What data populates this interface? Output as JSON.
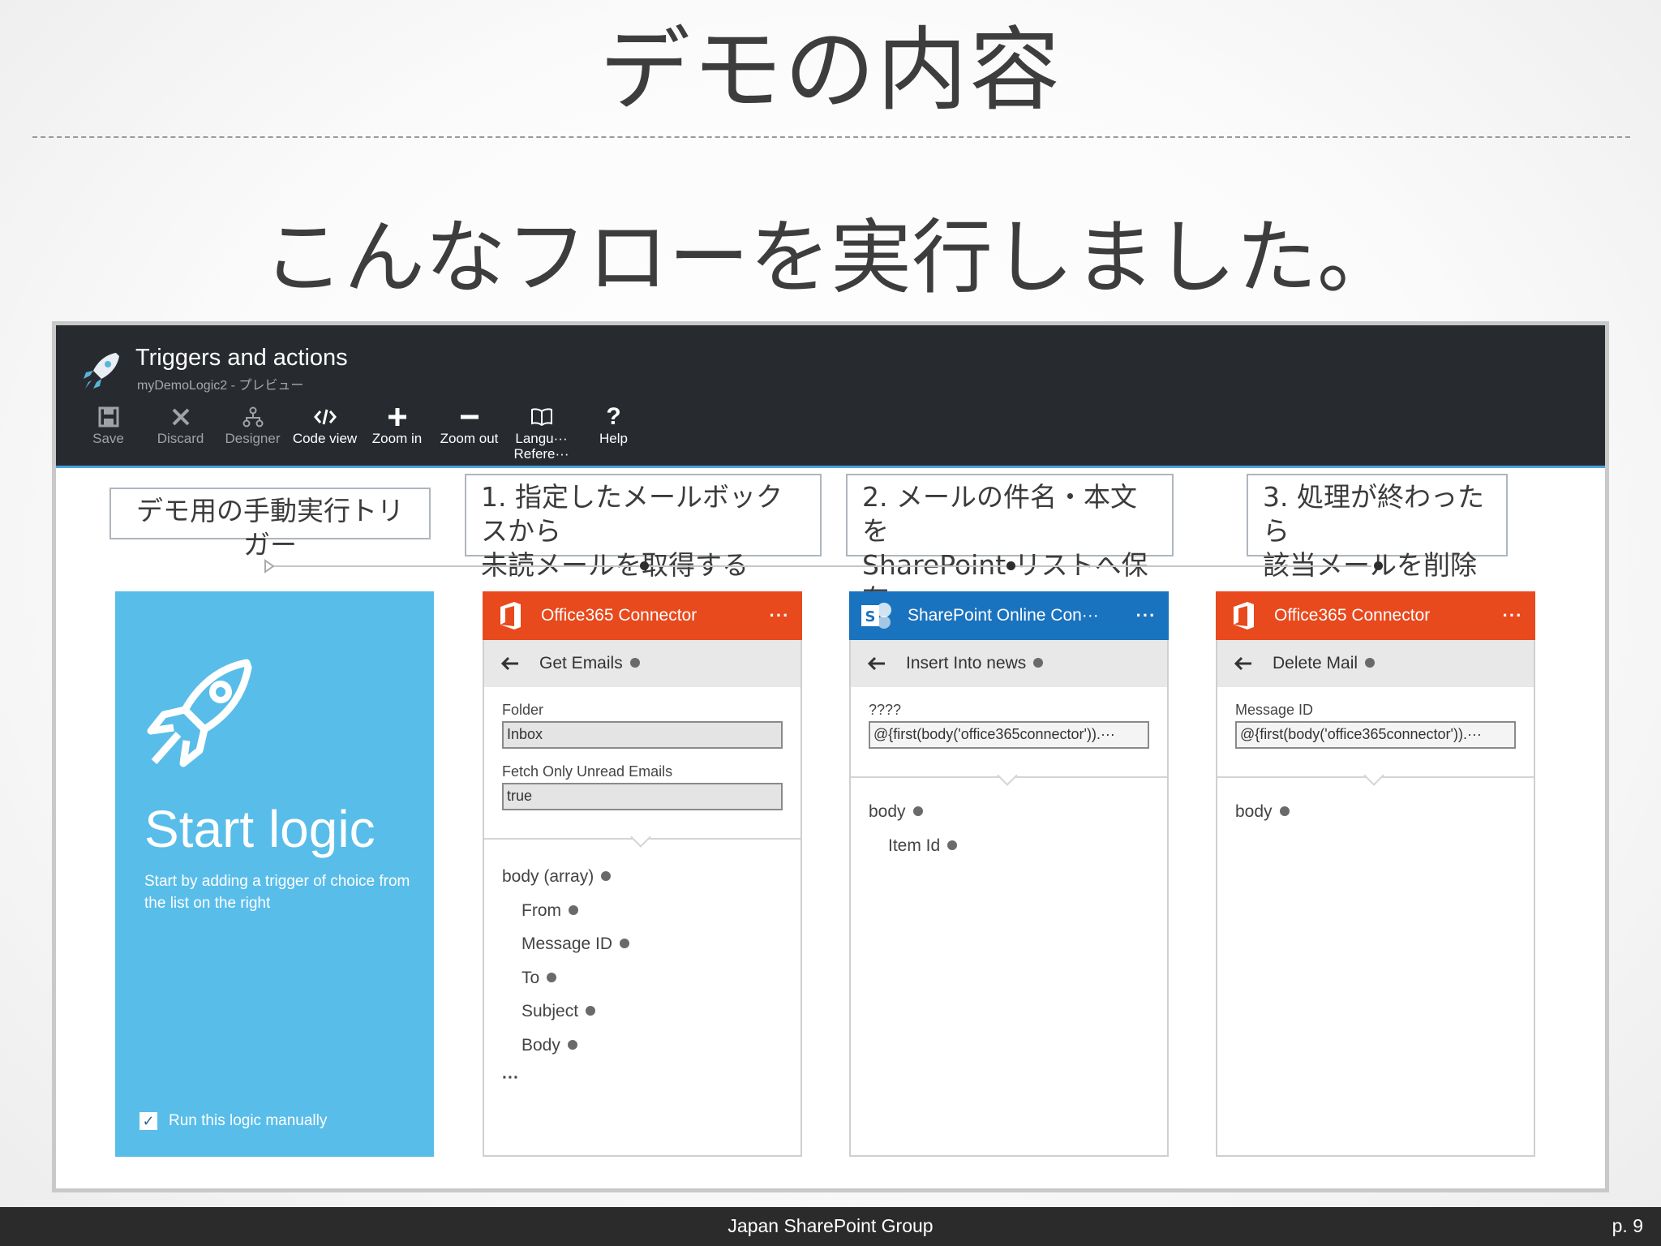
{
  "slide": {
    "title": "デモの内容",
    "subtitle": "こんなフローを実行しました。"
  },
  "window": {
    "title": "Triggers and actions",
    "subtitle": "myDemoLogic2 - プレビュー"
  },
  "toolbar": {
    "save": "Save",
    "discard": "Discard",
    "designer": "Designer",
    "code_view": "Code view",
    "zoom_in": "Zoom in",
    "zoom_out": "Zoom out",
    "language": "Langu··· Refere···",
    "help": "Help"
  },
  "callouts": {
    "trigger": "デモ用の手動実行トリガー",
    "step1_line1": "1. 指定したメールボックスから",
    "step1_line2": "未読メールを取得する",
    "step2_line1": "2. メールの件名・本文を",
    "step2_line2": "SharePoint リストへ保存",
    "step3_line1": "3. 処理が終わったら",
    "step3_line2": "該当メールを削除"
  },
  "start_card": {
    "title": "Start logic",
    "description": "Start by adding a trigger of choice from the list on the right",
    "checkbox_label": "Run this logic manually",
    "checked": true
  },
  "cards": {
    "get_emails": {
      "connector": "Office365 Connector",
      "menu": "···",
      "operation": "Get Emails",
      "folder_label": "Folder",
      "folder_value": "Inbox",
      "unread_label": "Fetch Only Unread Emails",
      "unread_value": "true",
      "output_root": "body (array)",
      "outputs": [
        "From",
        "Message ID",
        "To",
        "Subject",
        "Body"
      ],
      "more": "···"
    },
    "insert_news": {
      "connector": "SharePoint Online Con···",
      "menu": "···",
      "operation": "Insert Into news",
      "field_label": "????",
      "field_value": "@{first(body('office365connector')).···",
      "output_root": "body",
      "outputs": [
        "Item Id"
      ]
    },
    "delete_mail": {
      "connector": "Office365 Connector",
      "menu": "···",
      "operation": "Delete Mail",
      "field_label": "Message ID",
      "field_value": "@{first(body('office365connector')).···",
      "output_root": "body"
    }
  },
  "colors": {
    "header_bg": "#272b2f",
    "accent_blue": "#4aa3df",
    "start_card": "#58bde9",
    "office365": "#e8491d",
    "sharepoint": "#1a73be"
  },
  "footer": {
    "center": "Japan SharePoint Group",
    "page": "p. 9"
  }
}
